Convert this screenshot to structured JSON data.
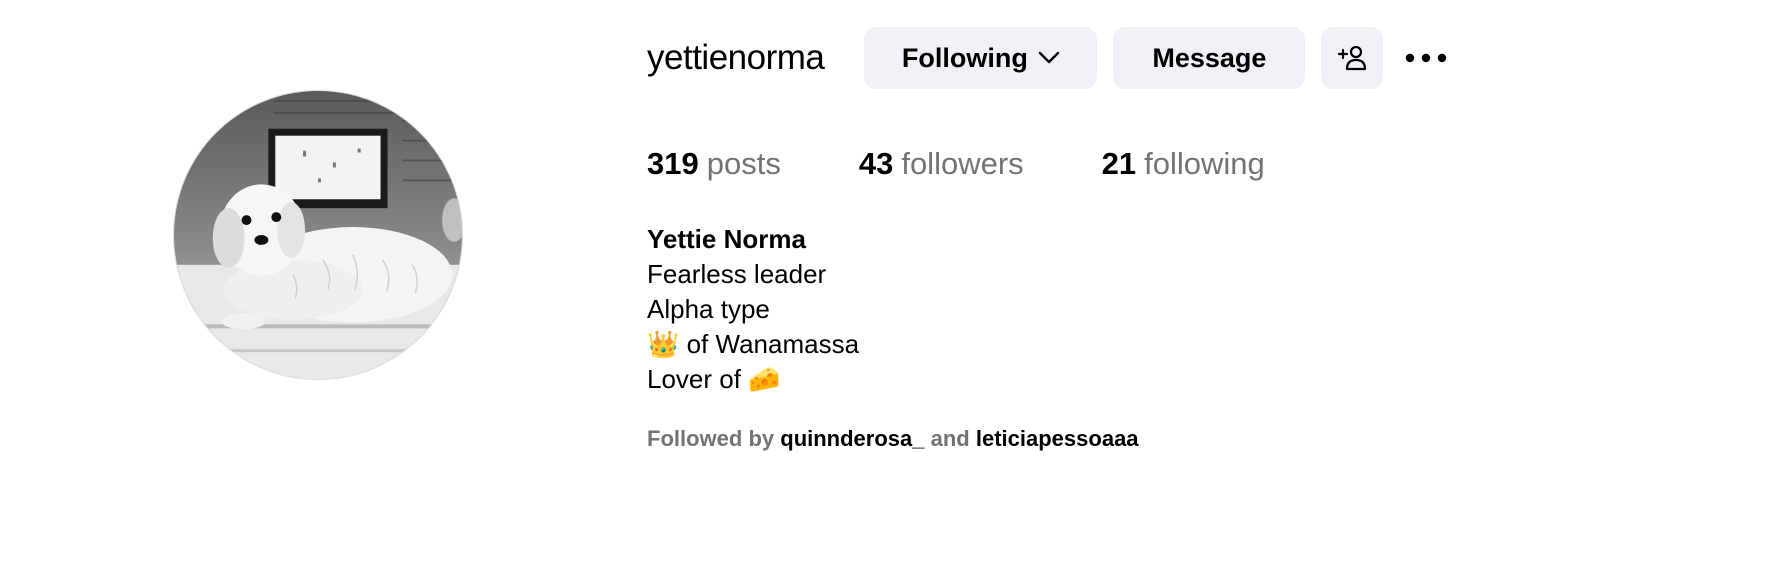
{
  "profile": {
    "username": "yettienorma",
    "full_name": "Yettie Norma",
    "avatar_icon": "dog-photo-avatar"
  },
  "actions": {
    "following_label": "Following",
    "message_label": "Message",
    "add_user_icon": "add-user-icon",
    "more_icon": "more-options-icon"
  },
  "stats": {
    "posts_count": "319",
    "posts_label": "posts",
    "followers_count": "43",
    "followers_label": "followers",
    "following_count": "21",
    "following_label": "following"
  },
  "bio": {
    "lines": [
      "Fearless leader",
      "Alpha type",
      "👑 of Wanamassa",
      "Lover of 🧀"
    ]
  },
  "followed_by": {
    "prefix": "Followed by",
    "accounts": [
      "quinnderosa_",
      "leticiapessoaaa"
    ],
    "conjunction": "and"
  },
  "colors": {
    "button_bg": "#eff1f5",
    "secondary_text": "#737373",
    "primary_text": "#000000"
  }
}
